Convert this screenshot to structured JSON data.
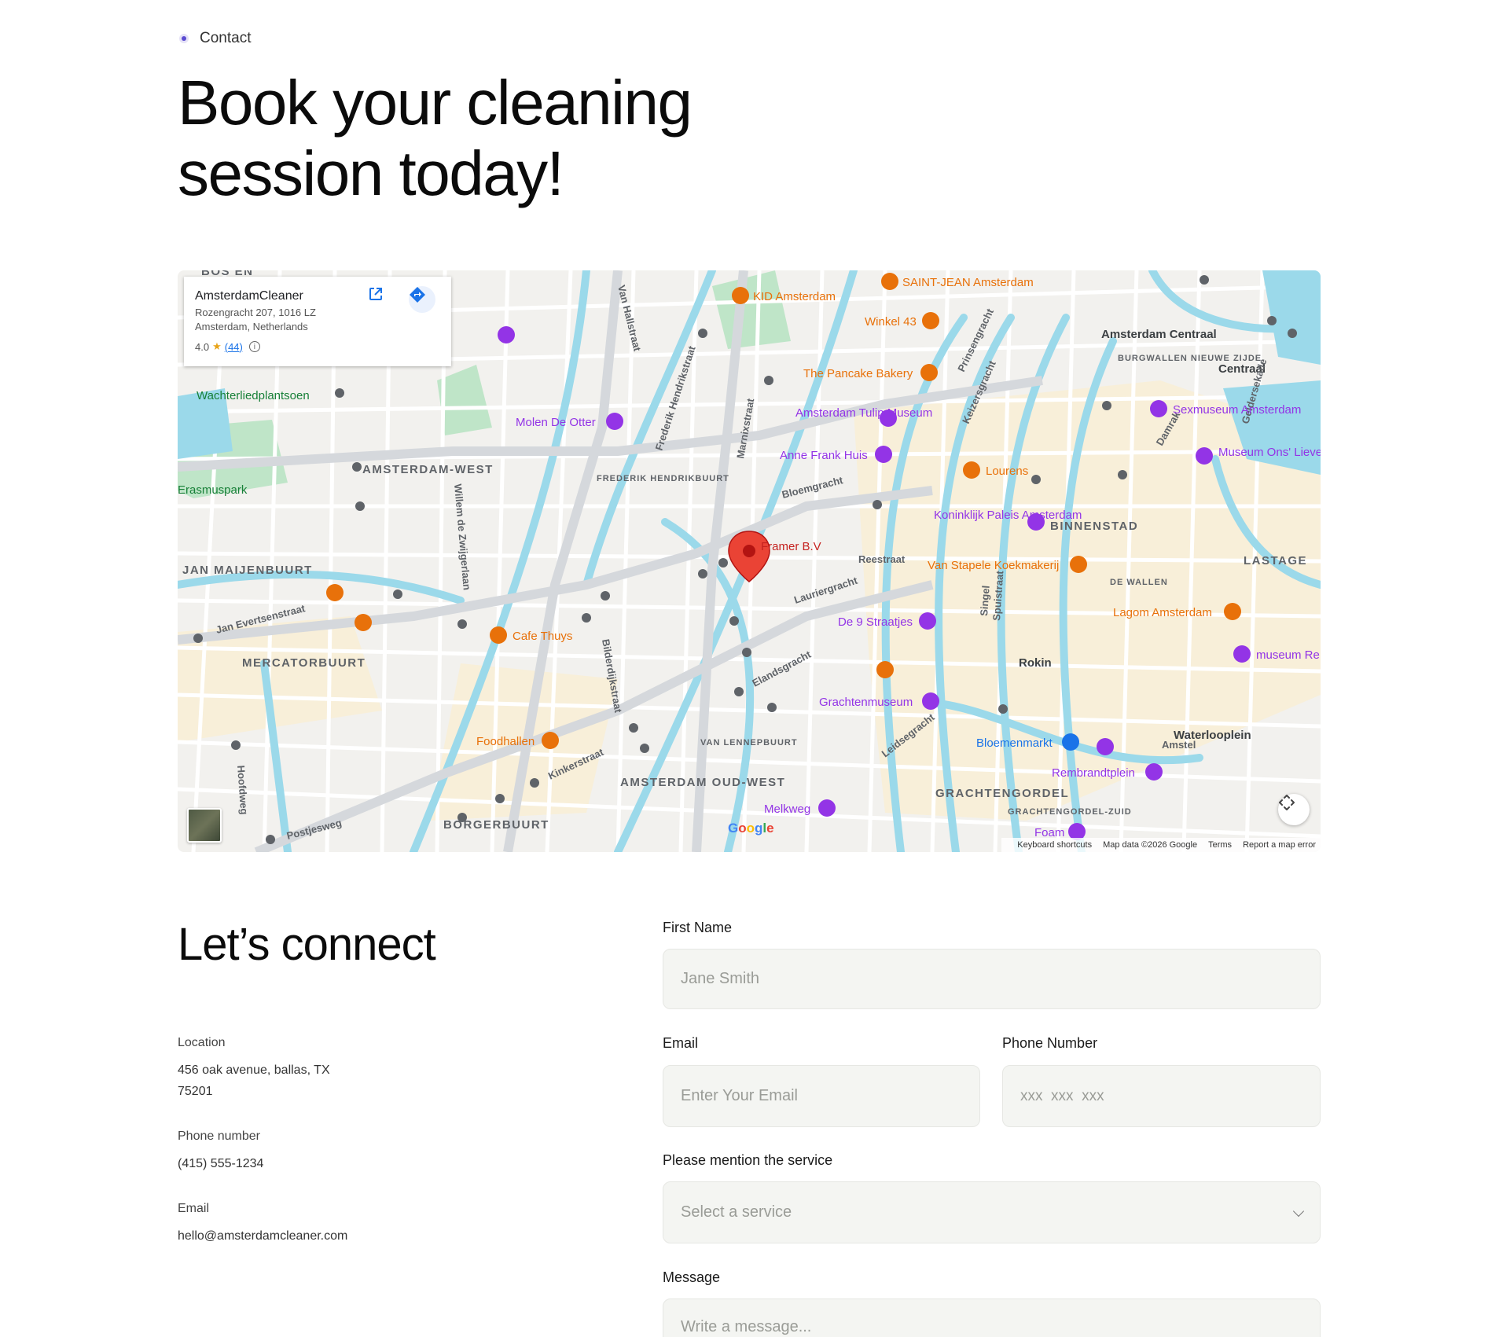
{
  "eyebrow": {
    "label": "Contact"
  },
  "hero": {
    "title": "Book your cleaning session today!"
  },
  "map": {
    "place_card": {
      "name": "AmsterdamCleaner",
      "address_line1": "Rozengracht 207, 1016 LZ",
      "address_line2": "Amsterdam, Netherlands",
      "rating": "4.0",
      "review_count": "(44)"
    },
    "pin_label": "Framer B.V",
    "labels": {
      "a": "AMSTERDAM-WEST",
      "b": "BINNENSTAD",
      "c": "JAN MAIJENBUURT",
      "d": "MERCATORBUURT",
      "e": "BORGERBUURT",
      "f": "AMSTERDAM OUD-WEST",
      "g": "GRACHTENGORDEL",
      "h": "LASTAGE",
      "i": "FREDERIK HENDRIKBUURT",
      "j": "VAN LENNEPBUURT",
      "k": "BURGWALLEN NIEUWE ZIJDE",
      "l": "DE WALLEN",
      "m": "GRACHTENGORDEL-ZUID",
      "n": "Erasmuspark",
      "o": "Wachterliedplantsoen",
      "p": "Amsterdam Centraal",
      "q": "Centraal",
      "r": "Rokin",
      "s": "Waterlooplein",
      "t": "BOS EN"
    },
    "pois": {
      "a": "KID Amsterdam",
      "b": "SAINT-JEAN Amsterdam",
      "c": "Winkel 43",
      "d": "The Pancake Bakery",
      "e": "Amsterdam Tulip Museum",
      "f": "Anne Frank Huis",
      "g": "Lourens",
      "h": "Koninklijk Paleis Amsterdam",
      "i": "Van Stapele Koekmakerij",
      "j": "Lagom Amsterdam",
      "k": "De 9 Straatjes",
      "l": "Grachtenmuseum",
      "m": "Bloemenmarkt",
      "n": "Rembrandtplein",
      "o": "Melkweg",
      "p": "Foam",
      "q": "Cafe Thuys",
      "r": "Foodhallen",
      "s": "Molen De Otter",
      "t": "Sexmuseum Amsterdam",
      "u": "Museum Ons' Lieve Heer op Solder",
      "v": "museum Re"
    },
    "streets": {
      "a": "Van Hallstraat",
      "b": "Frederik Hendrikstraat",
      "c": "Marnixstraat",
      "d": "Willem de Zwijgerlaan",
      "e": "Jan Evertsenstraat",
      "f": "Kinkerstraat",
      "g": "Bilderdijkstraat",
      "h": "Postjesweg",
      "i": "Hoofdweg",
      "j": "Bloemgracht",
      "k": "Reestraat",
      "l": "Lauriergracht",
      "m": "Elandsgracht",
      "n": "Leidsegracht",
      "o": "Prinsengracht",
      "p": "Keizersgracht",
      "q": "Singel",
      "r": "Spuistraat",
      "s": "Damrak",
      "t": "Geldersekade",
      "u": "Amstel"
    },
    "attribution": {
      "shortcuts": "Keyboard shortcuts",
      "data": "Map data ©2026 Google",
      "terms": "Terms",
      "report": "Report a map error"
    },
    "colors": {
      "water": "#9bd9ea",
      "road": "#ffffff",
      "major_road": "#d5d8dc",
      "park": "#bfe5c8",
      "commercial": "#f8efd9"
    }
  },
  "connect": {
    "title": "Let’s connect",
    "location_label": "Location",
    "location_value": "456 oak avenue, ballas, TX 75201",
    "phone_label": "Phone number",
    "phone_value": "(415) 555-1234",
    "email_label": "Email",
    "email_value": "hello@amsterdamcleaner.com"
  },
  "form": {
    "first_name_label": "First Name",
    "first_name_placeholder": "Jane Smith",
    "email_label": "Email",
    "email_placeholder": "Enter Your Email",
    "phone_label": "Phone Number",
    "phone_placeholder": "xxx  xxx  xxx",
    "service_label": "Please mention the service",
    "service_placeholder": "Select a service",
    "message_label": "Message",
    "message_placeholder": "Write a message..."
  }
}
